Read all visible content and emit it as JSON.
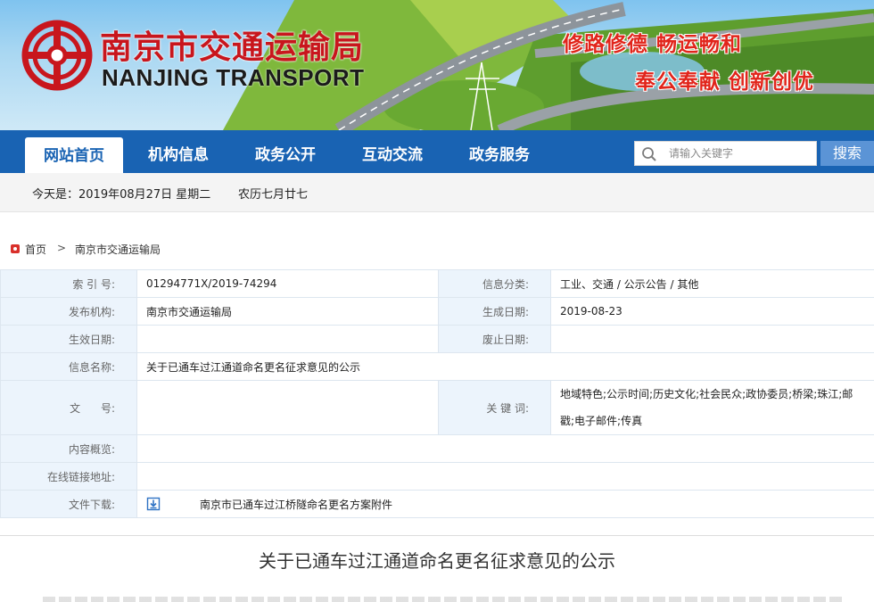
{
  "header": {
    "site_name_cn": "南京市交通运输局",
    "site_name_en": "NANJING TRANSPORT",
    "slogan_line1": "修路修德   畅运畅和",
    "slogan_line2": "奉公奉献   创新创优"
  },
  "nav": {
    "items": [
      {
        "label": "网站首页"
      },
      {
        "label": "机构信息"
      },
      {
        "label": "政务公开"
      },
      {
        "label": "互动交流"
      },
      {
        "label": "政务服务"
      }
    ],
    "search": {
      "placeholder": "请输入关键字",
      "button_label": "搜索"
    }
  },
  "datebar": {
    "today": "今天是：2019年08月27日 星期二",
    "lunar": "农历七月廿七"
  },
  "breadcrumb": {
    "home": "首页",
    "separator": ">",
    "current": "南京市交通运输局"
  },
  "info": {
    "index_label": "索 引 号:",
    "index_value": "01294771X/2019-74294",
    "category_label": "信息分类:",
    "category_value": "工业、交通 / 公示公告 / 其他",
    "publisher_label": "发布机构:",
    "publisher_value": "南京市交通运输局",
    "created_label": "生成日期:",
    "created_value": "2019-08-23",
    "effective_label": "生效日期:",
    "effective_value": "",
    "expire_label": "废止日期:",
    "expire_value": "",
    "name_label": "信息名称:",
    "name_value": "关于已通车过江通道命名更名征求意见的公示",
    "docno_label": "文      号:",
    "docno_value": "",
    "keywords_label": "关 键 词:",
    "keywords_value": "地域特色;公示时间;历史文化;社会民众;政协委员;桥梁;珠江;邮戳;电子邮件;传真",
    "summary_label": "内容概览:",
    "summary_value": "",
    "link_label": "在线链接地址:",
    "link_value": "",
    "download_label": "文件下载:",
    "download_value": "南京市已通车过江桥隧命名更名方案附件"
  },
  "article": {
    "title": "关于已通车过江通道命名更名征求意见的公示"
  },
  "colors": {
    "nav_bg": "#1963b3",
    "brand_red": "#c8161d",
    "label_bg": "#ecf4fc",
    "search_btn": "#5b94d6"
  }
}
